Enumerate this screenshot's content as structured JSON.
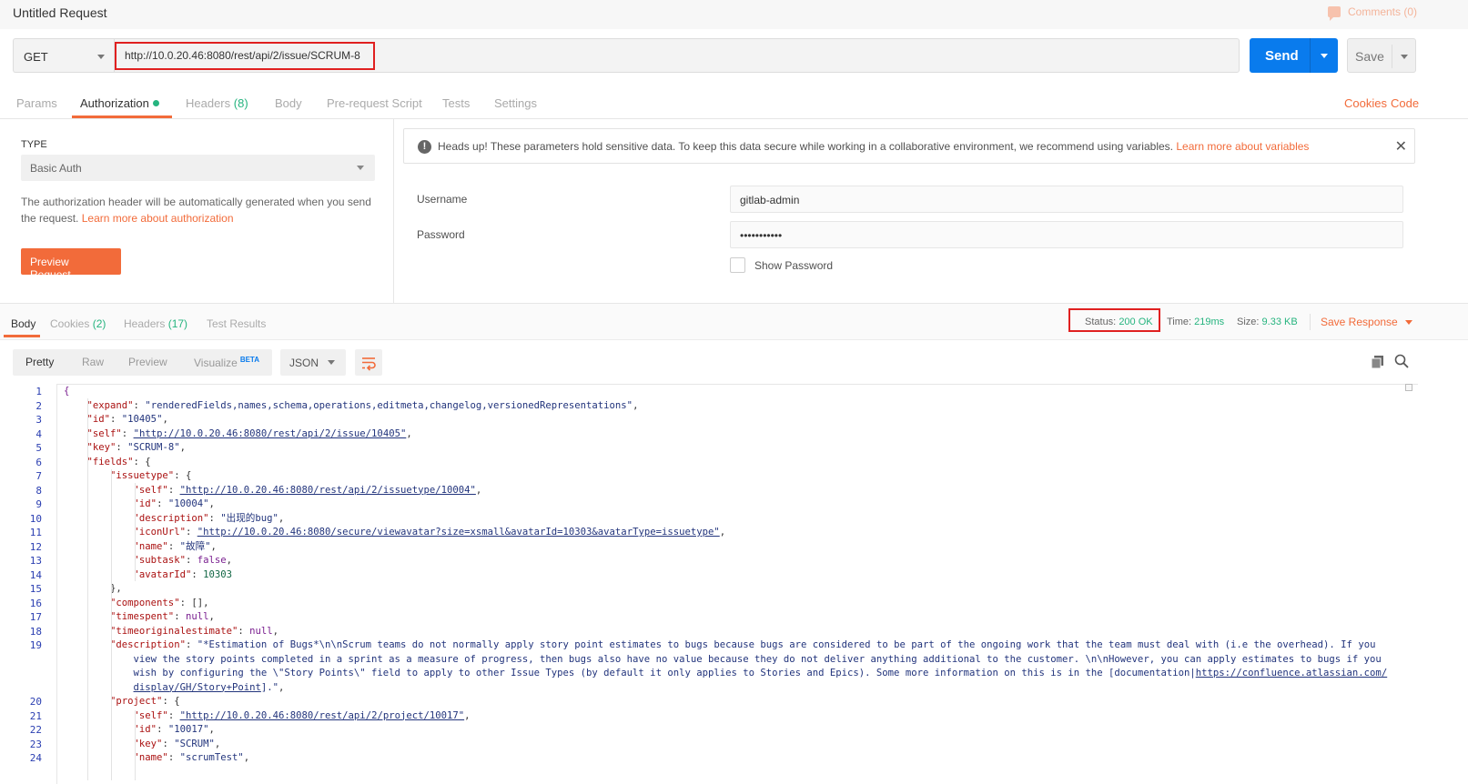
{
  "header": {
    "title": "Untitled Request",
    "comments_label": "Comments (0)"
  },
  "request": {
    "method": "GET",
    "url": "http://10.0.20.46:8080/rest/api/2/issue/SCRUM-8",
    "send_label": "Send",
    "save_label": "Save"
  },
  "request_tabs": {
    "params": "Params",
    "authorization": "Authorization",
    "headers": "Headers",
    "headers_count": "(8)",
    "body": "Body",
    "prerequest": "Pre-request Script",
    "tests": "Tests",
    "settings": "Settings",
    "cookies_link": "Cookies",
    "code_link": "Code"
  },
  "auth": {
    "type_label": "TYPE",
    "type_value": "Basic Auth",
    "desc_text": "The authorization header will be automatically generated when you send the request.",
    "desc_link": "Learn more about authorization",
    "preview_button": "Preview Request",
    "alert_text": "Heads up! These parameters hold sensitive data. To keep this data secure while working in a collaborative environment, we recommend using variables.",
    "alert_link": "Learn more about variables",
    "username_label": "Username",
    "username_value": "gitlab-admin",
    "password_label": "Password",
    "password_value": "•••••••••••",
    "show_password_label": "Show Password"
  },
  "response_tabs": {
    "body": "Body",
    "cookies": "Cookies",
    "cookies_count": "(2)",
    "headers": "Headers",
    "headers_count": "(17)",
    "test_results": "Test Results"
  },
  "response_meta": {
    "status_label": "Status:",
    "status_value": "200 OK",
    "time_label": "Time:",
    "time_value": "219ms",
    "size_label": "Size:",
    "size_value": "9.33 KB",
    "save_response": "Save Response"
  },
  "view_modes": {
    "pretty": "Pretty",
    "raw": "Raw",
    "preview": "Preview",
    "visualize": "Visualize",
    "beta": "BETA",
    "format": "JSON"
  },
  "code_lines": [
    "1",
    "2",
    "3",
    "4",
    "5",
    "6",
    "7",
    "8",
    "9",
    "10",
    "11",
    "12",
    "13",
    "14",
    "15",
    "16",
    "17",
    "18",
    "19",
    "",
    "",
    "",
    "20",
    "21",
    "22",
    "23",
    "24"
  ],
  "code": {
    "l1": "{",
    "l2_key": "\"expand\"",
    "l2_val": "\"renderedFields,names,schema,operations,editmeta,changelog,versionedRepresentations\"",
    "l3_key": "\"id\"",
    "l3_val": "\"10405\"",
    "l4_key": "\"self\"",
    "l4_val": "\"http://10.0.20.46:8080/rest/api/2/issue/10405\"",
    "l5_key": "\"key\"",
    "l5_val": "\"SCRUM-8\"",
    "l6_key": "\"fields\"",
    "l7_key": "\"issuetype\"",
    "l8_key": "\"self\"",
    "l8_val": "\"http://10.0.20.46:8080/rest/api/2/issuetype/10004\"",
    "l9_key": "\"id\"",
    "l9_val": "\"10004\"",
    "l10_key": "\"description\"",
    "l10_val": "\"出现的bug\"",
    "l11_key": "\"iconUrl\"",
    "l11_val": "\"http://10.0.20.46:8080/secure/viewavatar?size=xsmall&avatarId=10303&avatarType=issuetype\"",
    "l12_key": "\"name\"",
    "l12_val": "\"故障\"",
    "l13_key": "\"subtask\"",
    "l13_val": "false",
    "l14_key": "\"avatarId\"",
    "l14_val": "10303",
    "l15": "},",
    "l16_key": "\"components\"",
    "l16_val": "[]",
    "l17_key": "\"timespent\"",
    "l17_val": "null",
    "l18_key": "\"timeoriginalestimate\"",
    "l18_val": "null",
    "l19_key": "\"description\"",
    "l19_val_a": "\"*Estimation of Bugs*\\n\\nScrum teams do not normally apply story point estimates to bugs because bugs are considered to be part of the ongoing work that the team must deal with (i.e the overhead). If you",
    "l19_val_b": "view the story points completed in a sprint as a measure of progress, then bugs also have no value because they do not deliver anything additional to the customer. \\n\\nHowever, you can apply estimates to bugs if you",
    "l19_val_c": "wish by configuring the \\\"Story Points\\\" field to apply to other Issue Types (by default it only applies to Stories and Epics). Some more information on this is in the [documentation|",
    "l19_val_c_url": "https://confluence.atlassian.com/",
    "l19_val_d_url": "display/GH/Story+Point",
    "l19_val_d": "].\"",
    "l20_key": "\"project\"",
    "l21_key": "\"self\"",
    "l21_val": "\"http://10.0.20.46:8080/rest/api/2/project/10017\"",
    "l22_key": "\"id\"",
    "l22_val": "\"10017\"",
    "l23_key": "\"key\"",
    "l23_val": "\"SCRUM\"",
    "l24_key": "\"name\"",
    "l24_val": "\"scrumTest\""
  }
}
